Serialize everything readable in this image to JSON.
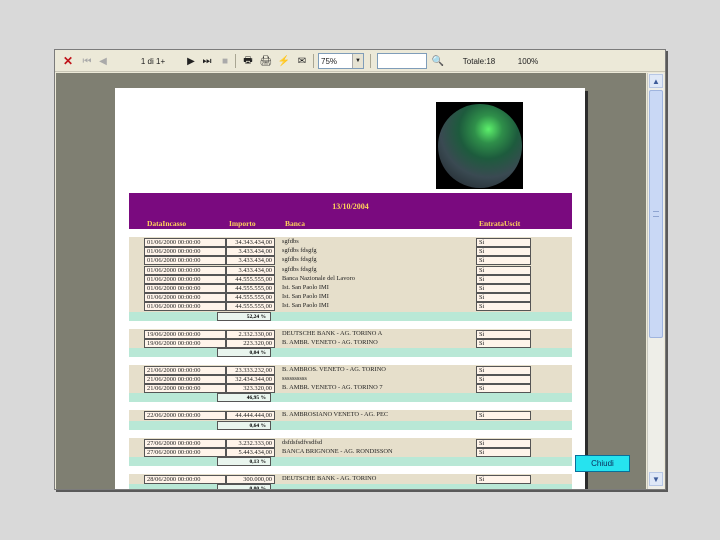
{
  "toolbar": {
    "page_indicator": "1 di 1+",
    "zoom": "75%",
    "search_value": "",
    "total_label": "Totale:18",
    "progress": "100%"
  },
  "report": {
    "date": "13/10/2004",
    "columns": [
      "DataIncasso",
      "Importo",
      "Banca",
      "EntrataUscit"
    ],
    "groups": [
      {
        "rows": [
          {
            "date": "01/06/2000 00:00:00",
            "amount": "34.343.434,00",
            "bank": "sgfdbs",
            "flag": "Sì"
          },
          {
            "date": "01/06/2000 00:00:00",
            "amount": "3.433.434,00",
            "bank": "sgfdbs fdsgfg",
            "flag": "Sì"
          },
          {
            "date": "01/06/2000 00:00:00",
            "amount": "3.433.434,00",
            "bank": "sgfdbs fdsgfg",
            "flag": "Sì"
          },
          {
            "date": "01/06/2000 00:00:00",
            "amount": "3.433.434,00",
            "bank": "sgfdbs fdsgfg",
            "flag": "Sì"
          },
          {
            "date": "01/06/2000 00:00:00",
            "amount": "44.555.555,00",
            "bank": "Banca Nazionale del Lavoro",
            "flag": "Sì"
          },
          {
            "date": "01/06/2000 00:00:00",
            "amount": "44.555.555,00",
            "bank": "Ist. San Paolo IMI",
            "flag": "Sì"
          },
          {
            "date": "01/06/2000 00:00:00",
            "amount": "44.555.555,00",
            "bank": "Ist. San Paolo IMI",
            "flag": "Sì"
          },
          {
            "date": "01/06/2000 00:00:00",
            "amount": "44.555.555,00",
            "bank": "Ist. San Paolo IMI",
            "flag": "Sì"
          }
        ],
        "total": "52,24 %"
      },
      {
        "rows": [
          {
            "date": "19/06/2000 00:00:00",
            "amount": "2.332.330,00",
            "bank": "DEUTSCHE BANK - AG. TORINO A",
            "flag": "Sì"
          },
          {
            "date": "19/06/2000 00:00:00",
            "amount": "223.320,00",
            "bank": "B. AMBR. VENETO - AG. TORINO",
            "flag": "Sì"
          }
        ],
        "total": "0,04 %"
      },
      {
        "rows": [
          {
            "date": "21/06/2000 00:00:00",
            "amount": "23.333.232,00",
            "bank": "B. AMBROS. VENETO - AG. TORINO",
            "flag": "Sì"
          },
          {
            "date": "21/06/2000 00:00:00",
            "amount": "32.434.344,00",
            "bank": "ssssssssss",
            "flag": "Sì"
          },
          {
            "date": "21/06/2000 00:00:00",
            "amount": "323.320,00",
            "bank": "B. AMBR. VENETO - AG. TORINO 7",
            "flag": "Sì"
          }
        ],
        "total": "46,95 %"
      },
      {
        "rows": [
          {
            "date": "22/06/2000 00:00:00",
            "amount": "44.444.444,00",
            "bank": "B. AMBROSIANO VENETO - AG. PEC",
            "flag": "Sì"
          }
        ],
        "total": "0,64 %"
      },
      {
        "rows": [
          {
            "date": "27/06/2000 00:00:00",
            "amount": "3.232.333,00",
            "bank": "dsfdsfsdfvsdfsd",
            "flag": "Sì"
          },
          {
            "date": "27/06/2000 00:00:00",
            "amount": "5.443.434,00",
            "bank": "BANCA BRIGNONE - AG. RONDISSON",
            "flag": "Sì"
          }
        ],
        "total": "0,13 %"
      },
      {
        "rows": [
          {
            "date": "28/06/2000 00:00:00",
            "amount": "300.000,00",
            "bank": "DEUTSCHE BANK - AG. TORINO",
            "flag": "Sì"
          }
        ],
        "total": "0,00 %"
      }
    ]
  },
  "close_button": "Chiudi",
  "colors": {
    "header_band": "#7a0a7f",
    "header_text": "#ffd35a",
    "group_bg": "#e6dfcb",
    "total_bar": "#b9e8d6",
    "close_button_bg": "#26e3ef"
  }
}
